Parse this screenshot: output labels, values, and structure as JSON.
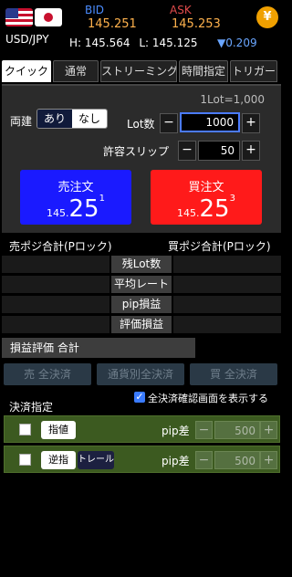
{
  "header": {
    "pair": "USD/JPY",
    "bid_label": "BID",
    "ask_label": "ASK",
    "bid": "145.251",
    "ask": "145.253",
    "high": "H: 145.564",
    "low": "L: 145.125",
    "change": "▼0.209",
    "yen_icon": "¥"
  },
  "tabs": [
    "クイック",
    "通常",
    "ストリーミング",
    "時間指定",
    "トリガー"
  ],
  "active_tab": "クイック",
  "order": {
    "lot_unit": "1Lot=1,000",
    "both_label": "両建",
    "both_options": [
      "あり",
      "なし"
    ],
    "both_selected": "なし",
    "lot_label": "Lot数",
    "lot_value": "1000",
    "slip_label": "許容スリップ",
    "slip_value": "50",
    "minus": "−",
    "plus": "+",
    "sell_label": "売注文",
    "sell_price_small": "145.",
    "sell_price_big": "25",
    "sell_price_sup": "1",
    "buy_label": "買注文",
    "buy_price_small": "145.",
    "buy_price_big": "25",
    "buy_price_sup": "3"
  },
  "positions": {
    "sell_total": "売ポジ合計(Pロック)",
    "buy_total": "買ポジ合計(Pロック)",
    "rows": [
      "残Lot数",
      "平均レート",
      "pip損益",
      "評価損益"
    ],
    "eval_total": "損益評価 合計"
  },
  "settle": {
    "sell_all": "売 全決済",
    "by_currency": "通貨別全決済",
    "buy_all": "買 全決済",
    "confirm_label": "全決済確認画面を表示する",
    "confirm_checked": true,
    "section_label": "決済指定",
    "limit_label": "指値",
    "stop_label": "逆指",
    "trail_label": "トレール",
    "pip_diff": "pip差",
    "limit_value": "500",
    "stop_value": "500"
  }
}
